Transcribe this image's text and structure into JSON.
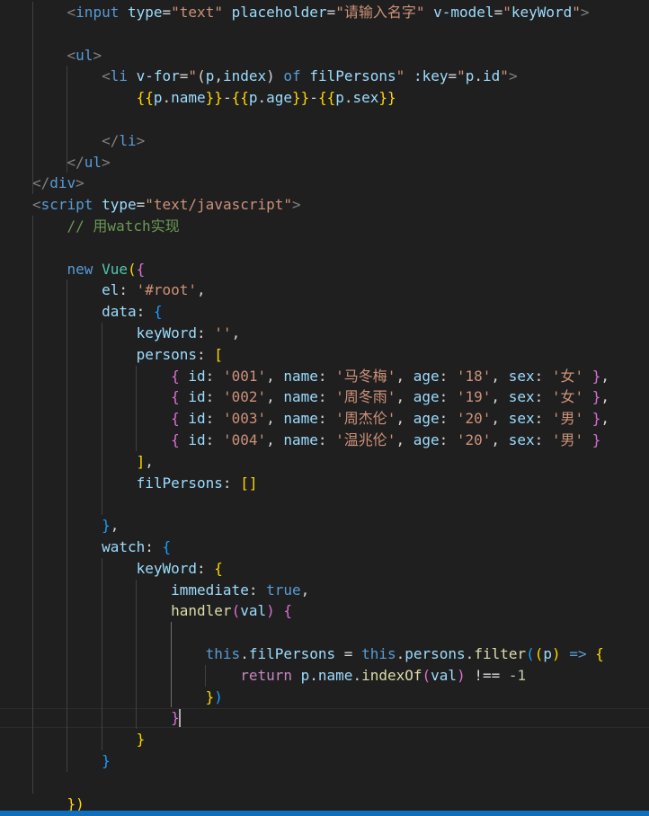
{
  "code_lines": [
    [
      {
        "t": "    ",
        "c": "plain"
      },
      {
        "t": "<",
        "c": "bracket-tag"
      },
      {
        "t": "input",
        "c": "tag"
      },
      {
        "t": " ",
        "c": "plain"
      },
      {
        "t": "type",
        "c": "attr"
      },
      {
        "t": "=",
        "c": "plain"
      },
      {
        "t": "\"text\"",
        "c": "str"
      },
      {
        "t": " ",
        "c": "plain"
      },
      {
        "t": "placeholder",
        "c": "attr"
      },
      {
        "t": "=",
        "c": "plain"
      },
      {
        "t": "\"请输入名字\"",
        "c": "str"
      },
      {
        "t": " ",
        "c": "plain"
      },
      {
        "t": "v-model",
        "c": "attr"
      },
      {
        "t": "=",
        "c": "plain"
      },
      {
        "t": "\"",
        "c": "str"
      },
      {
        "t": "keyWord",
        "c": "var"
      },
      {
        "t": "\"",
        "c": "str"
      },
      {
        "t": ">",
        "c": "bracket-tag"
      }
    ],
    [],
    [
      {
        "t": "    ",
        "c": "plain"
      },
      {
        "t": "<",
        "c": "bracket-tag"
      },
      {
        "t": "ul",
        "c": "tag"
      },
      {
        "t": ">",
        "c": "bracket-tag"
      }
    ],
    [
      {
        "t": "        ",
        "c": "plain"
      },
      {
        "t": "<",
        "c": "bracket-tag"
      },
      {
        "t": "li",
        "c": "tag"
      },
      {
        "t": " ",
        "c": "plain"
      },
      {
        "t": "v-for",
        "c": "attr"
      },
      {
        "t": "=",
        "c": "plain"
      },
      {
        "t": "\"",
        "c": "str"
      },
      {
        "t": "(",
        "c": "plain"
      },
      {
        "t": "p",
        "c": "var"
      },
      {
        "t": ",",
        "c": "plain"
      },
      {
        "t": "index",
        "c": "var"
      },
      {
        "t": ") ",
        "c": "plain"
      },
      {
        "t": "of",
        "c": "kw"
      },
      {
        "t": " ",
        "c": "plain"
      },
      {
        "t": "filPersons",
        "c": "var"
      },
      {
        "t": "\"",
        "c": "str"
      },
      {
        "t": " ",
        "c": "plain"
      },
      {
        "t": ":key",
        "c": "attr"
      },
      {
        "t": "=",
        "c": "plain"
      },
      {
        "t": "\"",
        "c": "str"
      },
      {
        "t": "p",
        "c": "var"
      },
      {
        "t": ".",
        "c": "plain"
      },
      {
        "t": "id",
        "c": "prop"
      },
      {
        "t": "\"",
        "c": "str"
      },
      {
        "t": ">",
        "c": "bracket-tag"
      }
    ],
    [
      {
        "t": "            ",
        "c": "plain"
      },
      {
        "t": "{{",
        "c": "b1"
      },
      {
        "t": "p",
        "c": "var"
      },
      {
        "t": ".",
        "c": "plain"
      },
      {
        "t": "name",
        "c": "prop"
      },
      {
        "t": "}}",
        "c": "b1"
      },
      {
        "t": "-",
        "c": "plain"
      },
      {
        "t": "{{",
        "c": "b1"
      },
      {
        "t": "p",
        "c": "var"
      },
      {
        "t": ".",
        "c": "plain"
      },
      {
        "t": "age",
        "c": "prop"
      },
      {
        "t": "}}",
        "c": "b1"
      },
      {
        "t": "-",
        "c": "plain"
      },
      {
        "t": "{{",
        "c": "b1"
      },
      {
        "t": "p",
        "c": "var"
      },
      {
        "t": ".",
        "c": "plain"
      },
      {
        "t": "sex",
        "c": "prop"
      },
      {
        "t": "}}",
        "c": "b1"
      }
    ],
    [],
    [
      {
        "t": "        ",
        "c": "plain"
      },
      {
        "t": "</",
        "c": "bracket-tag"
      },
      {
        "t": "li",
        "c": "tag"
      },
      {
        "t": ">",
        "c": "bracket-tag"
      }
    ],
    [
      {
        "t": "    ",
        "c": "plain"
      },
      {
        "t": "</",
        "c": "bracket-tag"
      },
      {
        "t": "ul",
        "c": "tag"
      },
      {
        "t": ">",
        "c": "bracket-tag"
      }
    ],
    [
      {
        "t": "</",
        "c": "bracket-tag"
      },
      {
        "t": "div",
        "c": "tag"
      },
      {
        "t": ">",
        "c": "bracket-tag"
      }
    ],
    [
      {
        "t": "<",
        "c": "bracket-tag"
      },
      {
        "t": "script",
        "c": "tag"
      },
      {
        "t": " ",
        "c": "plain"
      },
      {
        "t": "type",
        "c": "attr"
      },
      {
        "t": "=",
        "c": "plain"
      },
      {
        "t": "\"text/javascript\"",
        "c": "str"
      },
      {
        "t": ">",
        "c": "bracket-tag"
      }
    ],
    [
      {
        "t": "    ",
        "c": "plain"
      },
      {
        "t": "// 用watch实现",
        "c": "cmt"
      }
    ],
    [],
    [
      {
        "t": "    ",
        "c": "plain"
      },
      {
        "t": "new",
        "c": "kw"
      },
      {
        "t": " ",
        "c": "plain"
      },
      {
        "t": "Vue",
        "c": "cls"
      },
      {
        "t": "(",
        "c": "b1"
      },
      {
        "t": "{",
        "c": "b2"
      }
    ],
    [
      {
        "t": "        ",
        "c": "plain"
      },
      {
        "t": "el",
        "c": "prop"
      },
      {
        "t": ": ",
        "c": "plain"
      },
      {
        "t": "'#root'",
        "c": "str"
      },
      {
        "t": ",",
        "c": "plain"
      }
    ],
    [
      {
        "t": "        ",
        "c": "plain"
      },
      {
        "t": "data",
        "c": "prop"
      },
      {
        "t": ": ",
        "c": "plain"
      },
      {
        "t": "{",
        "c": "b3"
      }
    ],
    [
      {
        "t": "            ",
        "c": "plain"
      },
      {
        "t": "keyWord",
        "c": "prop"
      },
      {
        "t": ": ",
        "c": "plain"
      },
      {
        "t": "''",
        "c": "str"
      },
      {
        "t": ",",
        "c": "plain"
      }
    ],
    [
      {
        "t": "            ",
        "c": "plain"
      },
      {
        "t": "persons",
        "c": "prop"
      },
      {
        "t": ": ",
        "c": "plain"
      },
      {
        "t": "[",
        "c": "b1"
      }
    ],
    [
      {
        "t": "                ",
        "c": "plain"
      },
      {
        "t": "{",
        "c": "b2"
      },
      {
        "t": " ",
        "c": "plain"
      },
      {
        "t": "id",
        "c": "prop"
      },
      {
        "t": ": ",
        "c": "plain"
      },
      {
        "t": "'001'",
        "c": "str"
      },
      {
        "t": ", ",
        "c": "plain"
      },
      {
        "t": "name",
        "c": "prop"
      },
      {
        "t": ": ",
        "c": "plain"
      },
      {
        "t": "'马冬梅'",
        "c": "str"
      },
      {
        "t": ", ",
        "c": "plain"
      },
      {
        "t": "age",
        "c": "prop"
      },
      {
        "t": ": ",
        "c": "plain"
      },
      {
        "t": "'18'",
        "c": "str"
      },
      {
        "t": ", ",
        "c": "plain"
      },
      {
        "t": "sex",
        "c": "prop"
      },
      {
        "t": ": ",
        "c": "plain"
      },
      {
        "t": "'女'",
        "c": "str"
      },
      {
        "t": " ",
        "c": "plain"
      },
      {
        "t": "}",
        "c": "b2"
      },
      {
        "t": ",",
        "c": "plain"
      }
    ],
    [
      {
        "t": "                ",
        "c": "plain"
      },
      {
        "t": "{",
        "c": "b2"
      },
      {
        "t": " ",
        "c": "plain"
      },
      {
        "t": "id",
        "c": "prop"
      },
      {
        "t": ": ",
        "c": "plain"
      },
      {
        "t": "'002'",
        "c": "str"
      },
      {
        "t": ", ",
        "c": "plain"
      },
      {
        "t": "name",
        "c": "prop"
      },
      {
        "t": ": ",
        "c": "plain"
      },
      {
        "t": "'周冬雨'",
        "c": "str"
      },
      {
        "t": ", ",
        "c": "plain"
      },
      {
        "t": "age",
        "c": "prop"
      },
      {
        "t": ": ",
        "c": "plain"
      },
      {
        "t": "'19'",
        "c": "str"
      },
      {
        "t": ", ",
        "c": "plain"
      },
      {
        "t": "sex",
        "c": "prop"
      },
      {
        "t": ": ",
        "c": "plain"
      },
      {
        "t": "'女'",
        "c": "str"
      },
      {
        "t": " ",
        "c": "plain"
      },
      {
        "t": "}",
        "c": "b2"
      },
      {
        "t": ",",
        "c": "plain"
      }
    ],
    [
      {
        "t": "                ",
        "c": "plain"
      },
      {
        "t": "{",
        "c": "b2"
      },
      {
        "t": " ",
        "c": "plain"
      },
      {
        "t": "id",
        "c": "prop"
      },
      {
        "t": ": ",
        "c": "plain"
      },
      {
        "t": "'003'",
        "c": "str"
      },
      {
        "t": ", ",
        "c": "plain"
      },
      {
        "t": "name",
        "c": "prop"
      },
      {
        "t": ": ",
        "c": "plain"
      },
      {
        "t": "'周杰伦'",
        "c": "str"
      },
      {
        "t": ", ",
        "c": "plain"
      },
      {
        "t": "age",
        "c": "prop"
      },
      {
        "t": ": ",
        "c": "plain"
      },
      {
        "t": "'20'",
        "c": "str"
      },
      {
        "t": ", ",
        "c": "plain"
      },
      {
        "t": "sex",
        "c": "prop"
      },
      {
        "t": ": ",
        "c": "plain"
      },
      {
        "t": "'男'",
        "c": "str"
      },
      {
        "t": " ",
        "c": "plain"
      },
      {
        "t": "}",
        "c": "b2"
      },
      {
        "t": ",",
        "c": "plain"
      }
    ],
    [
      {
        "t": "                ",
        "c": "plain"
      },
      {
        "t": "{",
        "c": "b2"
      },
      {
        "t": " ",
        "c": "plain"
      },
      {
        "t": "id",
        "c": "prop"
      },
      {
        "t": ": ",
        "c": "plain"
      },
      {
        "t": "'004'",
        "c": "str"
      },
      {
        "t": ", ",
        "c": "plain"
      },
      {
        "t": "name",
        "c": "prop"
      },
      {
        "t": ": ",
        "c": "plain"
      },
      {
        "t": "'温兆伦'",
        "c": "str"
      },
      {
        "t": ", ",
        "c": "plain"
      },
      {
        "t": "age",
        "c": "prop"
      },
      {
        "t": ": ",
        "c": "plain"
      },
      {
        "t": "'20'",
        "c": "str"
      },
      {
        "t": ", ",
        "c": "plain"
      },
      {
        "t": "sex",
        "c": "prop"
      },
      {
        "t": ": ",
        "c": "plain"
      },
      {
        "t": "'男'",
        "c": "str"
      },
      {
        "t": " ",
        "c": "plain"
      },
      {
        "t": "}",
        "c": "b2"
      }
    ],
    [
      {
        "t": "            ",
        "c": "plain"
      },
      {
        "t": "]",
        "c": "b1"
      },
      {
        "t": ",",
        "c": "plain"
      }
    ],
    [
      {
        "t": "            ",
        "c": "plain"
      },
      {
        "t": "filPersons",
        "c": "prop"
      },
      {
        "t": ": ",
        "c": "plain"
      },
      {
        "t": "[]",
        "c": "b1"
      }
    ],
    [],
    [
      {
        "t": "        ",
        "c": "plain"
      },
      {
        "t": "}",
        "c": "b3"
      },
      {
        "t": ",",
        "c": "plain"
      }
    ],
    [
      {
        "t": "        ",
        "c": "plain"
      },
      {
        "t": "watch",
        "c": "prop"
      },
      {
        "t": ": ",
        "c": "plain"
      },
      {
        "t": "{",
        "c": "b3"
      }
    ],
    [
      {
        "t": "            ",
        "c": "plain"
      },
      {
        "t": "keyWord",
        "c": "prop"
      },
      {
        "t": ": ",
        "c": "plain"
      },
      {
        "t": "{",
        "c": "b1"
      }
    ],
    [
      {
        "t": "                ",
        "c": "plain"
      },
      {
        "t": "immediate",
        "c": "prop"
      },
      {
        "t": ": ",
        "c": "plain"
      },
      {
        "t": "true",
        "c": "kw"
      },
      {
        "t": ",",
        "c": "plain"
      }
    ],
    [
      {
        "t": "                ",
        "c": "plain"
      },
      {
        "t": "handler",
        "c": "fn"
      },
      {
        "t": "(",
        "c": "b2"
      },
      {
        "t": "val",
        "c": "var"
      },
      {
        "t": ")",
        "c": "b2"
      },
      {
        "t": " ",
        "c": "plain"
      },
      {
        "t": "{",
        "c": "b2"
      }
    ],
    [],
    [
      {
        "t": "                    ",
        "c": "plain"
      },
      {
        "t": "this",
        "c": "kw"
      },
      {
        "t": ".",
        "c": "plain"
      },
      {
        "t": "filPersons",
        "c": "prop"
      },
      {
        "t": " = ",
        "c": "plain"
      },
      {
        "t": "this",
        "c": "kw"
      },
      {
        "t": ".",
        "c": "plain"
      },
      {
        "t": "persons",
        "c": "prop"
      },
      {
        "t": ".",
        "c": "plain"
      },
      {
        "t": "filter",
        "c": "fn"
      },
      {
        "t": "(",
        "c": "b3"
      },
      {
        "t": "(",
        "c": "b1"
      },
      {
        "t": "p",
        "c": "var"
      },
      {
        "t": ")",
        "c": "b1"
      },
      {
        "t": " ",
        "c": "plain"
      },
      {
        "t": "=>",
        "c": "kw"
      },
      {
        "t": " ",
        "c": "plain"
      },
      {
        "t": "{",
        "c": "b1"
      }
    ],
    [
      {
        "t": "                        ",
        "c": "plain"
      },
      {
        "t": "return",
        "c": "ctrl"
      },
      {
        "t": " ",
        "c": "plain"
      },
      {
        "t": "p",
        "c": "var"
      },
      {
        "t": ".",
        "c": "plain"
      },
      {
        "t": "name",
        "c": "prop"
      },
      {
        "t": ".",
        "c": "plain"
      },
      {
        "t": "indexOf",
        "c": "fn"
      },
      {
        "t": "(",
        "c": "b2"
      },
      {
        "t": "val",
        "c": "var"
      },
      {
        "t": ")",
        "c": "b2"
      },
      {
        "t": " !== ",
        "c": "plain"
      },
      {
        "t": "-1",
        "c": "num"
      }
    ],
    [
      {
        "t": "                    ",
        "c": "plain"
      },
      {
        "t": "}",
        "c": "b1"
      },
      {
        "t": ")",
        "c": "b3"
      }
    ],
    [
      {
        "t": "                ",
        "c": "plain"
      },
      {
        "t": "}",
        "c": "b2"
      }
    ],
    [
      {
        "t": "            ",
        "c": "plain"
      },
      {
        "t": "}",
        "c": "b1"
      }
    ],
    [
      {
        "t": "        ",
        "c": "plain"
      },
      {
        "t": "}",
        "c": "b3"
      }
    ],
    [],
    [
      {
        "t": "    ",
        "c": "plain"
      },
      {
        "t": "})",
        "c": "b1"
      }
    ]
  ],
  "colors": {
    "background": "#1f1f1f",
    "status_bar": "#0e6fbf"
  }
}
